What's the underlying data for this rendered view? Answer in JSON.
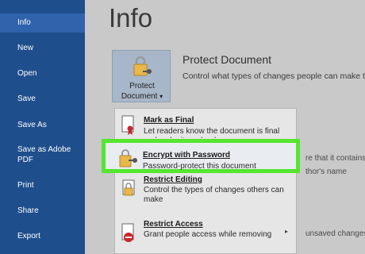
{
  "sidebar": {
    "items": [
      {
        "label": "Info"
      },
      {
        "label": "New"
      },
      {
        "label": "Open"
      },
      {
        "label": "Save"
      },
      {
        "label": "Save As"
      },
      {
        "label": "Save as Adobe PDF"
      },
      {
        "label": "Print"
      },
      {
        "label": "Share"
      },
      {
        "label": "Export"
      }
    ]
  },
  "main": {
    "title": "Info",
    "protect_button": {
      "line1": "Protect",
      "line2": "Document",
      "caret": "▾"
    },
    "protect_heading": "Protect Document",
    "protect_desc": "Control what types of changes people can make to t",
    "bg_text": {
      "line1": "re that it contains:",
      "line2": "thor's name",
      "line3": "unsaved changes."
    }
  },
  "menu": {
    "items": [
      {
        "title": "Mark as Final",
        "desc": "Let readers know the document is final and make it read-only."
      },
      {
        "title": "Encrypt with Password",
        "desc": "Password-protect this document"
      },
      {
        "title": "Restrict Editing",
        "desc": "Control the types of changes others can make"
      },
      {
        "title": "Restrict Access",
        "desc": "Grant people access while removing"
      }
    ]
  },
  "colors": {
    "sidebar": "#1f4e8c",
    "highlight": "#55e62e"
  }
}
